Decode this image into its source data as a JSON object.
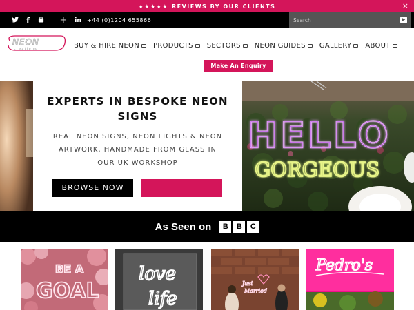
{
  "announcement": {
    "stars": "★★★★★",
    "text": "REVIEWS BY OUR CLIENTS",
    "close": "×"
  },
  "topbar": {
    "social": [
      {
        "name": "twitter-icon",
        "glyph": "𝕏"
      },
      {
        "name": "facebook-icon",
        "glyph": "f"
      },
      {
        "name": "instagram-icon",
        "glyph": "▣"
      }
    ],
    "plus": "+",
    "linkedin": "in",
    "phone": "+44 (0)1204 655866",
    "search_placeholder": "Search"
  },
  "logo": {
    "brand": "NEON",
    "tagline": "creations"
  },
  "nav": [
    {
      "label": "BUY & HIRE NEON"
    },
    {
      "label": "PRODUCTS"
    },
    {
      "label": "SECTORS"
    },
    {
      "label": "NEON GUIDES"
    },
    {
      "label": "GALLERY"
    },
    {
      "label": "ABOUT"
    }
  ],
  "enquiry_label": "Make An Enquiry",
  "hero": {
    "title": "EXPERTS IN BESPOKE NEON SIGNS",
    "subtitle": "REAL NEON SIGNS, NEON LIGHTS & NEON ARTWORK, HANDMADE FROM GLASS IN OUR UK WORKSHOP",
    "browse_label": "BROWSE NOW",
    "sign_line1": "HELLO",
    "sign_line2": "GORGEOUS"
  },
  "seen_on": {
    "text": "As Seen on",
    "letters": [
      "B",
      "B",
      "C"
    ]
  },
  "tiles": [
    {
      "line1": "BE A",
      "line2": "GOAL"
    },
    {
      "line1": "love",
      "line2": "life"
    },
    {
      "line1": "Just",
      "line2": "Married"
    },
    {
      "line1": "Pedro's",
      "line2": ""
    }
  ],
  "colors": {
    "accent": "#d4155a",
    "dark": "#000000"
  }
}
